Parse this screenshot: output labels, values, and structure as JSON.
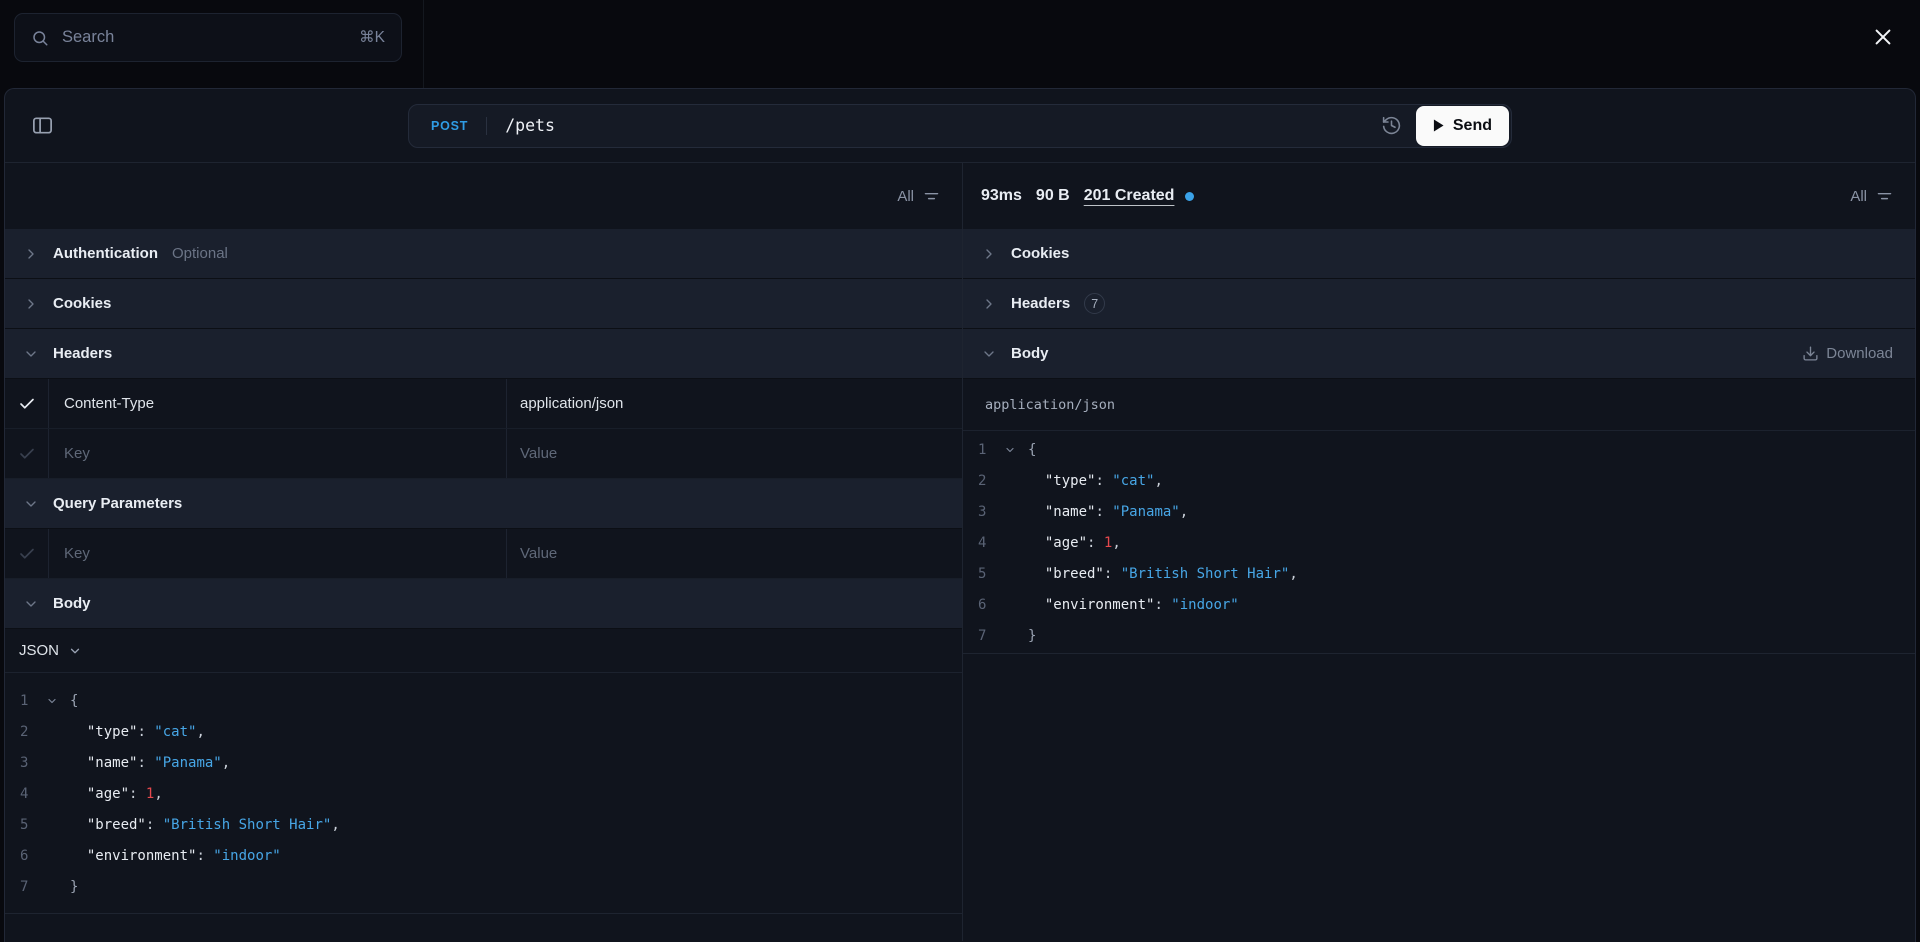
{
  "topbar": {
    "search_placeholder": "Search",
    "search_shortcut": "⌘K"
  },
  "toolbar": {
    "method": "POST",
    "path": "/pets",
    "send_label": "Send"
  },
  "request": {
    "filter_label": "All",
    "auth_label": "Authentication",
    "auth_badge": "Optional",
    "cookies_label": "Cookies",
    "headers_label": "Headers",
    "header_row": {
      "key": "Content-Type",
      "value": "application/json"
    },
    "key_placeholder": "Key",
    "value_placeholder": "Value",
    "query_label": "Query Parameters",
    "body_label": "Body",
    "body_format": "JSON"
  },
  "response": {
    "filter_label": "All",
    "duration": "93ms",
    "size": "90 B",
    "status": "201 Created",
    "cookies_label": "Cookies",
    "headers_label": "Headers",
    "headers_count": "7",
    "body_label": "Body",
    "download_label": "Download",
    "content_type": "application/json"
  },
  "json_body": {
    "lines": [
      {
        "num": "1",
        "fold": true,
        "tokens": [
          [
            "brace",
            "{"
          ]
        ]
      },
      {
        "num": "2",
        "fold": false,
        "tokens": [
          [
            "tk",
            "  "
          ],
          [
            "key",
            "\"type\""
          ],
          [
            "punct",
            ": "
          ],
          [
            "str",
            "\"cat\""
          ],
          [
            "punct",
            ","
          ]
        ]
      },
      {
        "num": "3",
        "fold": false,
        "tokens": [
          [
            "tk",
            "  "
          ],
          [
            "key",
            "\"name\""
          ],
          [
            "punct",
            ": "
          ],
          [
            "str",
            "\"Panama\""
          ],
          [
            "punct",
            ","
          ]
        ]
      },
      {
        "num": "4",
        "fold": false,
        "tokens": [
          [
            "tk",
            "  "
          ],
          [
            "key",
            "\"age\""
          ],
          [
            "punct",
            ": "
          ],
          [
            "num",
            "1"
          ],
          [
            "punct",
            ","
          ]
        ]
      },
      {
        "num": "5",
        "fold": false,
        "tokens": [
          [
            "tk",
            "  "
          ],
          [
            "key",
            "\"breed\""
          ],
          [
            "punct",
            ": "
          ],
          [
            "str",
            "\"British Short Hair\""
          ],
          [
            "punct",
            ","
          ]
        ]
      },
      {
        "num": "6",
        "fold": false,
        "tokens": [
          [
            "tk",
            "  "
          ],
          [
            "key",
            "\"environment\""
          ],
          [
            "punct",
            ": "
          ],
          [
            "str",
            "\"indoor\""
          ]
        ]
      },
      {
        "num": "7",
        "fold": false,
        "tokens": [
          [
            "brace",
            "}"
          ]
        ]
      }
    ]
  },
  "colors": {
    "accent_blue": "#2f9ce4",
    "string_blue": "#47a6e6",
    "number_red": "#e5484d",
    "status_dot_blue": "#3aa2e8",
    "send_button_bg": "#fafafa",
    "panel_bg": "#10141d",
    "section_bg": "#1a202d"
  }
}
